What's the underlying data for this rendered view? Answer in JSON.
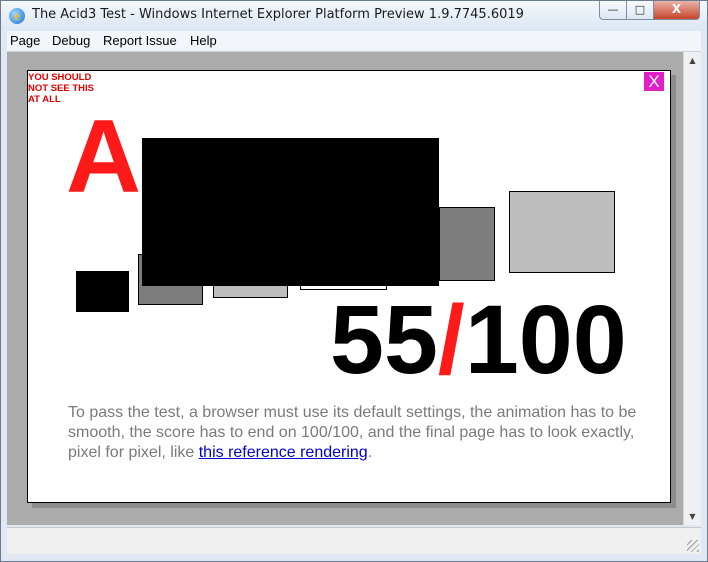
{
  "window": {
    "title": "The Acid3 Test - Windows Internet Explorer Platform Preview 1.9.7745.6019",
    "icon": "ie-logo-icon",
    "min_glyph": "—",
    "max_glyph": "□",
    "close_glyph": "X"
  },
  "menu": {
    "items": [
      "Page",
      "Debug",
      "Report Issue",
      "Help"
    ]
  },
  "page": {
    "warning": "YOU SHOULD NOT SEE THIS AT ALL",
    "close_x": "X",
    "heading_visible": "A",
    "score": {
      "value": "55",
      "separator": "/",
      "total": "100"
    },
    "description": "To pass the test, a browser must use its default settings, the animation has to be smooth, the score has to end on 100/100, and the final page has to look exactly, pixel for pixel, like ",
    "link_text": "this reference rendering",
    "description_end": "."
  },
  "colors": {
    "accent_red": "#ff1a1a",
    "close_magenta": "#e31ec8",
    "link_blue": "#0000cc"
  }
}
